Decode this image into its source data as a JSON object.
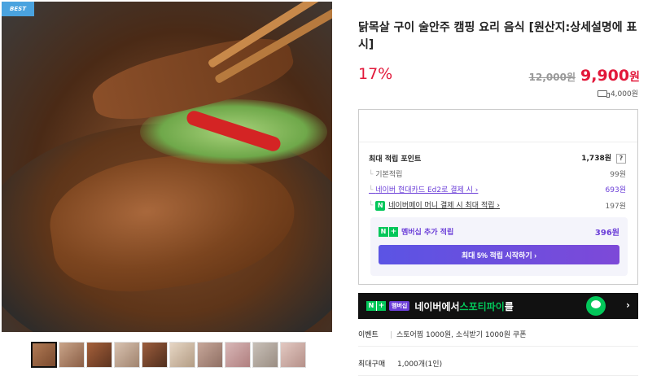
{
  "badge": "BEST",
  "product": {
    "title": "닭목살 구이 술안주 캠핑 요리 음식 [원산지:상세설명에 표시]",
    "discount": "17%",
    "original_price": "12,000원",
    "sale_price": "9,900",
    "sale_unit": "원",
    "shipping": "4,000원"
  },
  "points": {
    "max_label": "최대 적립 포인트",
    "max_value": "1,738원",
    "help": "?",
    "rows": [
      {
        "label": "기본적립",
        "value": "99원"
      },
      {
        "label": "네이버 현대카드 Ed2로 결제 시 ›",
        "value": "693원"
      },
      {
        "label": "네이버페이 머니 결제 시 최대 적립 ›",
        "value": "197원"
      }
    ],
    "npay_icon": "N",
    "member": {
      "badge_n": "N",
      "badge_plus": "+",
      "label": "멤버십 추가 적립",
      "value": "396원",
      "button": "최대 5% 적립 시작하기 ›"
    }
  },
  "banner": {
    "badge_n": "N",
    "badge_plus": "+",
    "membership": "멤버십",
    "text_before": "네이버에서 ",
    "highlight": "스포티파이",
    "text_after": "를",
    "chevron": "›"
  },
  "event": {
    "key": "이벤트",
    "value": "스토어찜 1000원, 소식받기 1000원 쿠폰"
  },
  "max_purchase": {
    "key": "최대구매",
    "value": "1,000개(1인)"
  }
}
